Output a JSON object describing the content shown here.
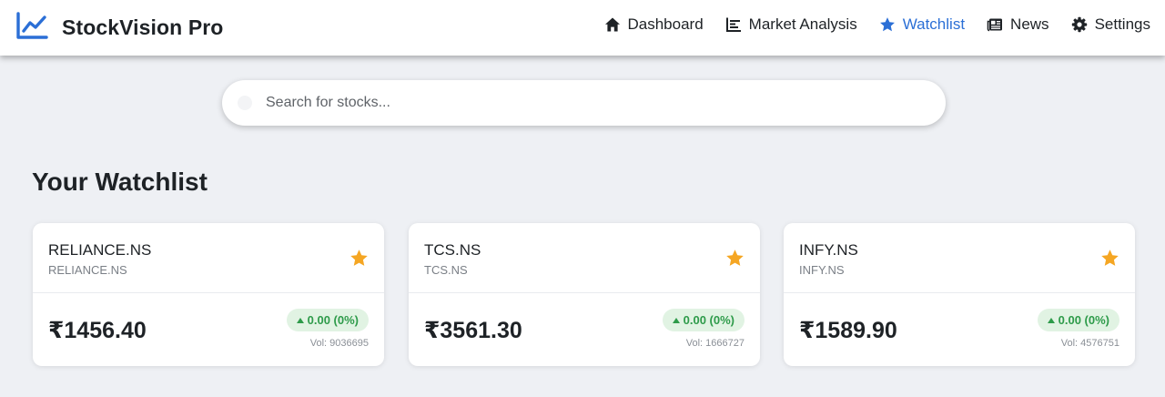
{
  "header": {
    "brand": "StockVision Pro",
    "nav": [
      {
        "label": "Dashboard",
        "icon": "home-icon"
      },
      {
        "label": "Market Analysis",
        "icon": "bar-chart-icon"
      },
      {
        "label": "Watchlist",
        "icon": "star-icon",
        "active": true
      },
      {
        "label": "News",
        "icon": "newspaper-icon"
      },
      {
        "label": "Settings",
        "icon": "gear-icon"
      }
    ]
  },
  "search": {
    "placeholder": "Search for stocks..."
  },
  "section": {
    "title": "Your Watchlist"
  },
  "watchlist": [
    {
      "symbol": "RELIANCE.NS",
      "name": "RELIANCE.NS",
      "price": "₹1456.40",
      "change": "0.00 (0%)",
      "volume": "Vol: 9036695"
    },
    {
      "symbol": "TCS.NS",
      "name": "TCS.NS",
      "price": "₹3561.30",
      "change": "0.00 (0%)",
      "volume": "Vol: 1666727"
    },
    {
      "symbol": "INFY.NS",
      "name": "INFY.NS",
      "price": "₹1589.90",
      "change": "0.00 (0%)",
      "volume": "Vol: 4576751"
    }
  ],
  "colors": {
    "accent": "#2b6fd6",
    "star": "#f5a623",
    "positive": "#2e9b4a",
    "positive_bg": "#e1f3e3",
    "background": "#eef0f4"
  }
}
